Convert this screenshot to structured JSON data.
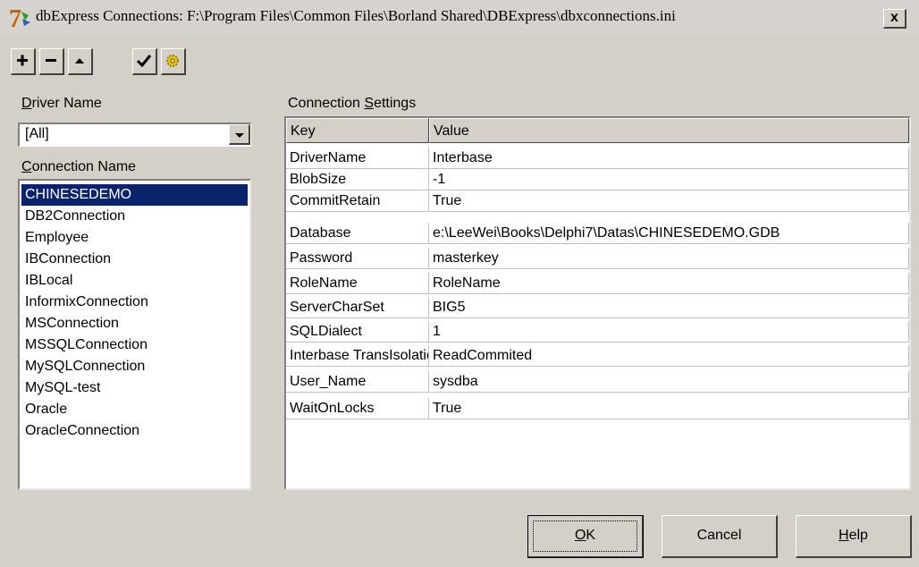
{
  "window": {
    "title": "dbExpress Connections: F:\\Program Files\\Common Files\\Borland Shared\\DBExpress\\dbxconnections.ini",
    "close_label": "x"
  },
  "toolbar": {
    "buttons": [
      {
        "icon": "plus-icon",
        "tooltip": ""
      },
      {
        "icon": "minus-icon",
        "tooltip": ""
      },
      {
        "icon": "triangle-up-icon",
        "tooltip": ""
      },
      {
        "icon": "checkmark-icon",
        "tooltip": ""
      },
      {
        "icon": "gear-icon",
        "tooltip": ""
      }
    ]
  },
  "driver": {
    "label_accel": "D",
    "label_rest": "river Name",
    "selected": "[All]"
  },
  "connections": {
    "label_accel": "C",
    "label_rest": "onnection Name",
    "items": [
      "CHINESEDEMO",
      "DB2Connection",
      "Employee",
      "IBConnection",
      "IBLocal",
      "InformixConnection",
      "MSConnection",
      "MSSQLConnection",
      "MySQLConnection",
      "MySQL-test",
      "Oracle",
      "OracleConnection"
    ],
    "selected": "CHINESEDEMO"
  },
  "settings": {
    "label_pre": "Connection ",
    "label_accel": "S",
    "label_rest": "ettings",
    "columns": [
      "Key",
      "Value"
    ],
    "rows": [
      {
        "key": "DriverName",
        "value": "Interbase"
      },
      {
        "key": "BlobSize",
        "value": "-1"
      },
      {
        "key": "CommitRetain",
        "value": "True"
      },
      {
        "key": "Database",
        "value": "e:\\LeeWei\\Books\\Delphi7\\Datas\\CHINESEDEMO.GDB"
      },
      {
        "key": "Password",
        "value": "masterkey"
      },
      {
        "key": "RoleName",
        "value": "RoleName"
      },
      {
        "key": "ServerCharSet",
        "value": "BIG5"
      },
      {
        "key": "SQLDialect",
        "value": "1"
      },
      {
        "key": "Interbase TransIsolation",
        "value": "ReadCommited"
      },
      {
        "key": "User_Name",
        "value": "sysdba"
      },
      {
        "key": "WaitOnLocks",
        "value": "True"
      }
    ]
  },
  "buttons": {
    "ok_accel": "O",
    "ok_rest": "K",
    "cancel": "Cancel",
    "help_accel": "H",
    "help_rest": "elp"
  },
  "colors": {
    "face": "#d4d0c8",
    "selection": "#0a246a"
  }
}
